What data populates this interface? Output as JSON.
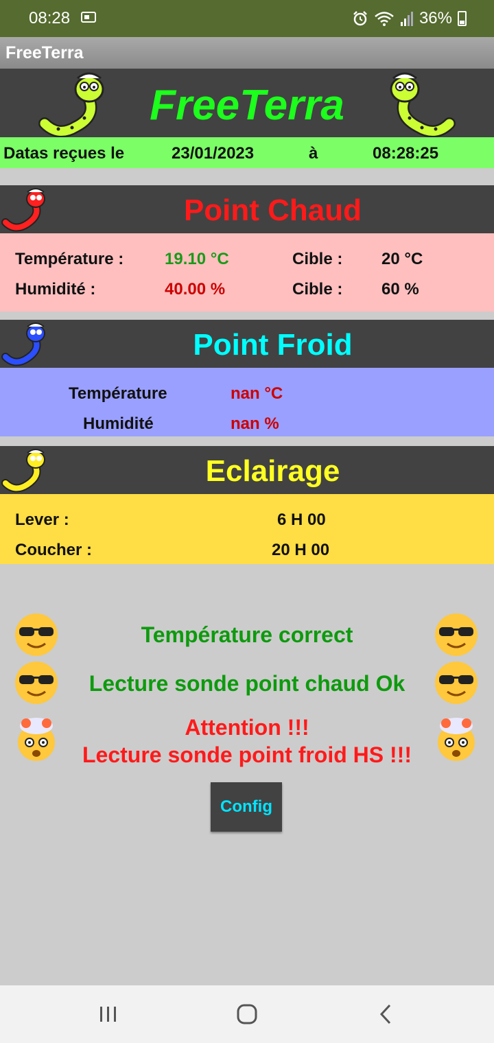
{
  "status_bar": {
    "time": "08:28",
    "battery": "36%",
    "icons": [
      "sim-card-icon",
      "alarm-icon",
      "wifi-icon",
      "signal-icon",
      "battery-icon"
    ]
  },
  "app_bar": {
    "title": "FreeTerra"
  },
  "header": {
    "title": "FreeTerra",
    "title_color": "#1cff1c"
  },
  "reception": {
    "label": "Datas reçues le",
    "date": "23/01/2023",
    "at": "à",
    "time": "08:28:25"
  },
  "hot_point": {
    "title": "Point Chaud",
    "title_color": "#ff1a1a",
    "temperature_label": "Température :",
    "temperature_value": "19.10 °C",
    "temperature_target_label": "Cible :",
    "temperature_target": "20 °C",
    "humidity_label": "Humidité :",
    "humidity_value": "40.00  %",
    "humidity_target_label": "Cible :",
    "humidity_target": "60  %"
  },
  "cold_point": {
    "title": "Point Froid",
    "title_color": "#00ffff",
    "temperature_label": "Température",
    "temperature_value": "nan °C",
    "humidity_label": "Humidité",
    "humidity_value": "nan  %"
  },
  "lighting": {
    "title": "Eclairage",
    "title_color": "#ffff22",
    "sunrise_label": "Lever :",
    "sunrise_value": "6 H 00",
    "sunset_label": "Coucher :",
    "sunset_value": "20 H 00"
  },
  "messages": {
    "temp_status": "Température correct",
    "hot_probe_status": "Lecture sonde point chaud Ok",
    "cold_probe_attention": "Attention !!!",
    "cold_probe_status": "Lecture sonde point froid  HS !!!",
    "ok_color": "#0e9a0e",
    "error_color": "#ff1a1a"
  },
  "config_button": {
    "label": "Config"
  },
  "nav": [
    "recent-apps-icon",
    "home-icon",
    "back-icon"
  ]
}
